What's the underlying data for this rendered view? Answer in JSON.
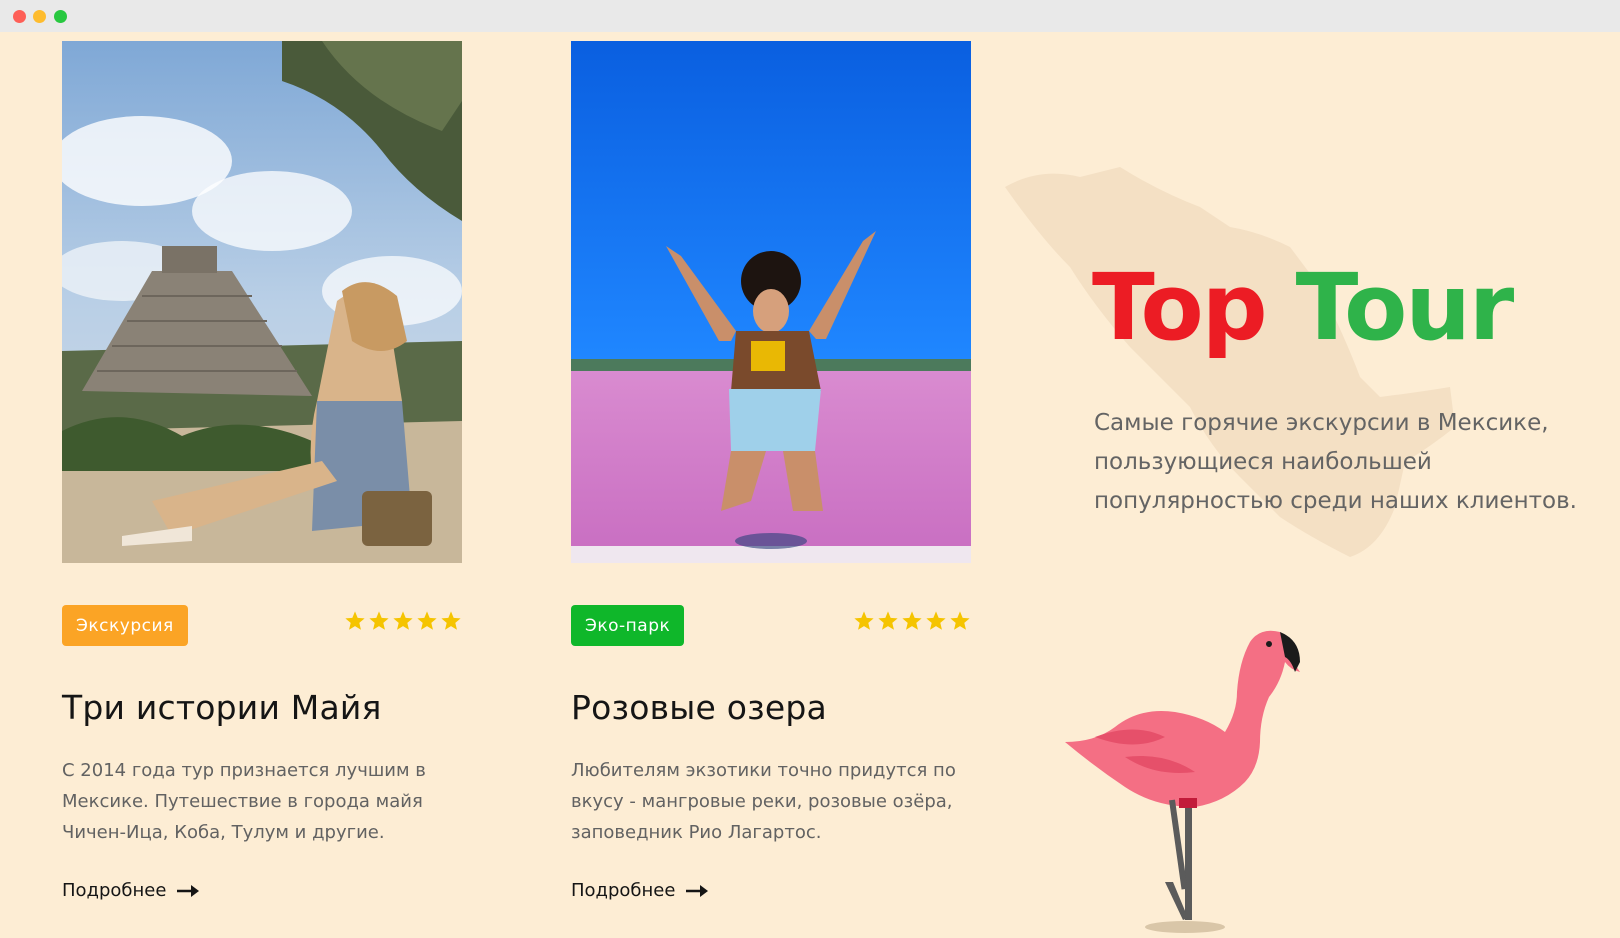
{
  "cards": [
    {
      "tag": "Экскурсия",
      "tag_color": "#fba425",
      "rating": 5,
      "title": "Три истории Майя",
      "description": "С 2014 года тур признается лучшим в Мексике. Путешествие в города майя Чичен-Ица, Коба, Тулум и другие.",
      "link": "Подробнее"
    },
    {
      "tag": "Эко-парк",
      "tag_color": "#0fb72a",
      "rating": 5,
      "title": "Розовые озера",
      "description": "Любителям экзотики точно придутся по вкусу - мангровые реки,  розовые озёра, заповедник Рио Лагартос.",
      "link": "Подробнее"
    }
  ],
  "hero": {
    "title_word1": "Top",
    "title_word2": "Tour",
    "title_color1": "#ec1c24",
    "title_color2": "#2fb34a",
    "subtitle": "Самые горячие экскурсии в Мексике, пользующиеся наибольшей популярностью среди наших клиентов."
  },
  "colors": {
    "page_bg": "#fdedd4",
    "star": "#f5c400"
  },
  "icons": {
    "rating": "star-icon",
    "link": "arrow-right-icon",
    "illustration": "flamingo-icon"
  }
}
